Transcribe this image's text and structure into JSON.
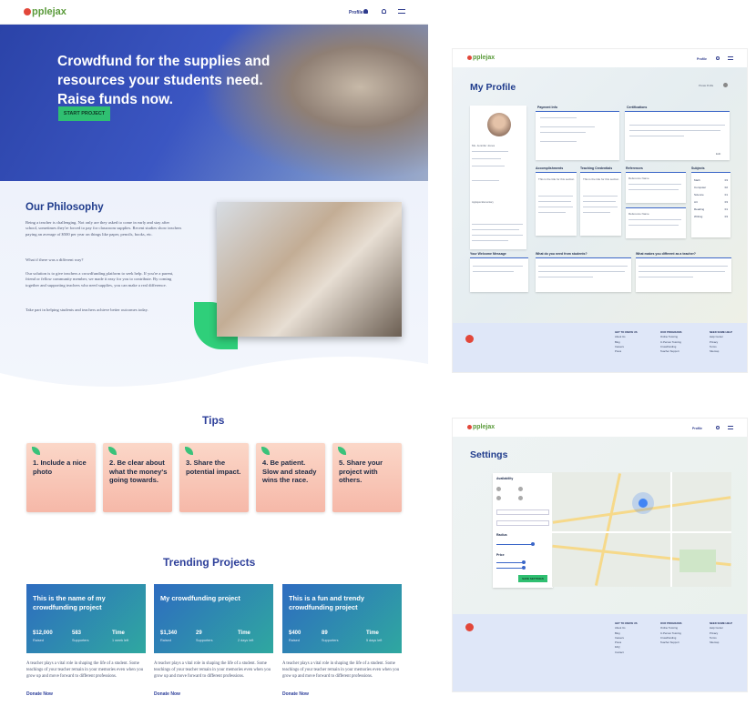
{
  "brand": {
    "name": "pplejax",
    "accent": "#2fbf71",
    "primary": "#2d3f9a"
  },
  "landing": {
    "nav": {
      "profile": "Profile"
    },
    "hero": {
      "headline": "Crowdfund for the supplies and resources your students need. Raise funds now.",
      "cta": "START PROJECT"
    },
    "philosophy": {
      "title": "Our Philosophy",
      "p1": "Being a teacher is challenging. Not only are they asked to come in early and stay after school, sometimes they're forced to pay for classroom supplies. Recent studies show teachers paying an average of $500 per year on things like paper, pencils, books, etc.",
      "p2": "What if there was a different way?",
      "p3": "Our solution is to give teachers a crowdfunding platform to seek help. If you're a parent, friend or fellow community member, we made it easy for you to contribute. By coming together and supporting teachers who need supplies, you can make a real difference.",
      "p4": "Take part in helping students and teachers achieve better outcomes today."
    },
    "tips": {
      "title": "Tips",
      "items": [
        "1. Include a nice photo",
        "2. Be clear about what the money's going towards.",
        "3. Share the potential impact.",
        "4. Be patient. Slow and steady wins the race.",
        "5. Share your project with others."
      ]
    },
    "trending": {
      "title": "Trending Projects",
      "projects": [
        {
          "name": "This is the name of my crowdfunding project",
          "raised": "$12,000",
          "supporters": "583",
          "time": "Time",
          "raised_label": "Raised",
          "supporters_label": "Supporters",
          "time_label": "1 week left"
        },
        {
          "name": "My crowdfunding project",
          "raised": "$1,340",
          "supporters": "29",
          "time": "Time",
          "raised_label": "Raised",
          "supporters_label": "Supporters",
          "time_label": "2 days left"
        },
        {
          "name": "This is a fun and trendy crowdfunding project",
          "raised": "$400",
          "supporters": "89",
          "time": "Time",
          "raised_label": "Raised",
          "supporters_label": "Supporters",
          "time_label": "5 days left"
        }
      ],
      "desc": "A teacher plays a vital role in shaping the life of a student. Some teachings of your teacher remain in your memories even when you grow up and move forward to different professions.",
      "donate": "Donate Now"
    }
  },
  "profile": {
    "nav": {
      "profile": "Profile"
    },
    "title": "My Profile",
    "toggle_label": "Private Profile",
    "user": {
      "name": "Ms. Jennifer Jones",
      "school": "Applejax Elementary"
    },
    "cards": {
      "payment": "Payment Info",
      "certifications": "Certifications",
      "accomplishments": "Accomplishments",
      "teaching": "Teaching Credentials",
      "references": "References",
      "subjects": "Subjects",
      "welcome": "Your Welcome Message",
      "students": "What do you need from students?",
      "different": "What makes you different as a teacher?"
    },
    "subjects": [
      [
        "Math",
        "03"
      ],
      [
        "Computer",
        "02"
      ],
      [
        "Science",
        "01"
      ],
      [
        "Art",
        "03"
      ],
      [
        "Reading",
        "01"
      ],
      [
        "Writing",
        "03"
      ]
    ],
    "card_titles": [
      "This is the title for this section",
      "This is the title for this section"
    ],
    "reference_names": [
      "Reference Name",
      "Reference Name"
    ],
    "edit": "Edit",
    "footer": {
      "cols": [
        {
          "head": "GET TO KNOW US",
          "items": [
            "About Us",
            "Blog",
            "Careers",
            "Press",
            "FAQ",
            "Contact"
          ]
        },
        {
          "head": "OUR PROGRAMS",
          "items": [
            "Online Tutoring",
            "In Person Tutoring",
            "Crowdfunding",
            "Teacher Support"
          ]
        },
        {
          "head": "NEED SOME HELP",
          "items": [
            "Help Center",
            "Privacy",
            "Terms",
            "Sitemap"
          ]
        }
      ]
    }
  },
  "settings": {
    "nav": {
      "profile": "Profile"
    },
    "title": "Settings",
    "panel": {
      "availability": "Availability",
      "radius": "Radius",
      "price": "Price",
      "save": "SAVE SETTINGS"
    }
  }
}
